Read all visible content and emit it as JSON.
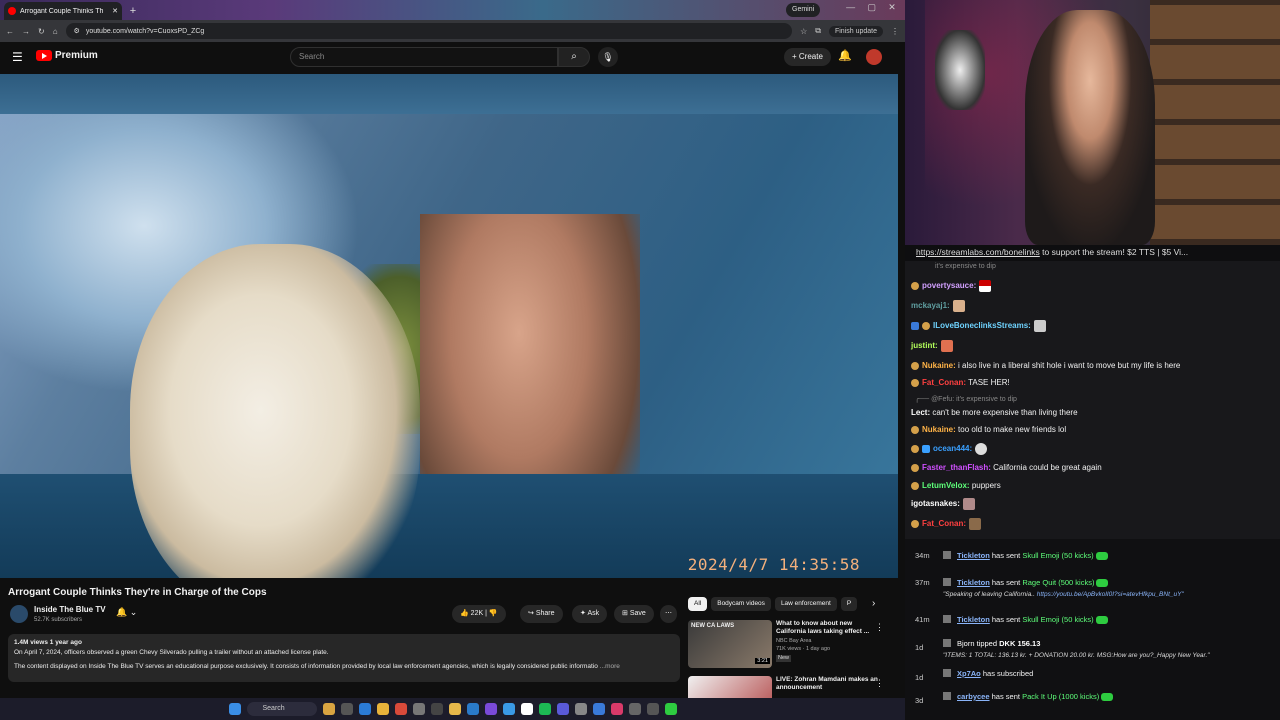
{
  "browser": {
    "tab_title": "Arrogant Couple Thinks Th",
    "new_tab": "+",
    "gemini_label": "Gemini",
    "url": "youtube.com/watch?v=CuoxsPD_ZCg",
    "finish_update": "Finish update"
  },
  "youtube": {
    "logo_text": "Premium",
    "search_placeholder": "Search",
    "create_label": "Create",
    "video_timestamp_overlay": "2024/4/7  14:35:58",
    "video_title": "Arrogant Couple Thinks They're in Charge of the Cops",
    "channel_name": "Inside The Blue TV",
    "channel_subs": "52.7K subscribers",
    "like_count": "22K",
    "share_label": "Share",
    "ask_label": "Ask",
    "save_label": "Save",
    "desc_stats": "1.4M views  1 year ago",
    "desc_line1": "On April 7, 2024, officers observed a green Chevy Silverado pulling a trailer without an attached license plate.",
    "desc_line2": "The content displayed on Inside The Blue TV serves an educational purpose exclusively. It consists of information provided by local law enforcement agencies, which is legally considered public informatio",
    "desc_more": "...more",
    "chips": [
      "All",
      "Bodycam videos",
      "Law enforcement",
      "P"
    ],
    "recs": [
      {
        "title": "What to know about new California laws taking effect ...",
        "channel": "NBC Bay Area",
        "meta": "71K views · 1 day ago",
        "badge": "New",
        "duration": "3:21",
        "thumb_text": "NEW CA LAWS"
      },
      {
        "title": "LIVE: Zohran Mamdani makes an announcement",
        "channel": "",
        "meta": "",
        "badge": "",
        "duration": "",
        "thumb_text": ""
      }
    ]
  },
  "taskbar": {
    "search_label": "Search"
  },
  "stream": {
    "banner_link": "https://streamlabs.com/bonelinks",
    "banner_text": " to support the stream! $2 TTS | $5 Vi..."
  },
  "chat": {
    "top_fragment": "it's expensive to dip",
    "messages": [
      {
        "user": "povertysauce:",
        "text": "",
        "color": "#d2a0ff"
      },
      {
        "user": "mckayaj1:",
        "text": "",
        "color": "#5f9ea0"
      },
      {
        "user": "ILoveBoneclinksStreams:",
        "text": "",
        "color": "#6fd3ff"
      },
      {
        "user": "justint:",
        "text": "",
        "color": "#b3ff5a"
      },
      {
        "user": "Nukaine:",
        "text": "i also live in a liberal shit hole i want to move but my life is here",
        "color": "#ffb347"
      },
      {
        "user": "Fat_Conan:",
        "text": "TASE HER!",
        "color": "#ff4040"
      },
      {
        "user": "Lect:",
        "text": "can't be more expensive than living there",
        "color": "#ffffff"
      },
      {
        "user": "Nukaine:",
        "text": "too old to make new friends lol",
        "color": "#ffb347"
      },
      {
        "user": "ocean444:",
        "text": "",
        "color": "#3aa0ff"
      },
      {
        "user": "Faster_thanFlash:",
        "text": "California could be great again",
        "color": "#d050ff"
      },
      {
        "user": "LetumVelox:",
        "text": "puppers",
        "color": "#5eff7a"
      },
      {
        "user": "igotasnakes:",
        "text": "",
        "color": "#ffffff"
      },
      {
        "user": "Fat_Conan:",
        "text": "",
        "color": "#ff4040"
      }
    ],
    "reply_fefu": "@Fefu: it's expensive to dip"
  },
  "events": [
    {
      "time": "34m",
      "user": "Tickleton",
      "action": "has sent",
      "item": "Skull Emoji (50 kicks)",
      "sub": ""
    },
    {
      "time": "37m",
      "user": "Tickleton",
      "action": "has sent",
      "item": "Rage Quit (500 kicks)",
      "sub": "\"Speaking of leaving California..",
      "sub_link": "https://youtu.be/ApBvkolI0I?si=atevHfkpu_BNt_uY\""
    },
    {
      "time": "41m",
      "user": "Tickleton",
      "action": "has sent",
      "item": "Skull Emoji (50 kicks)",
      "sub": ""
    },
    {
      "time": "1d",
      "user": "Bjorn tipped",
      "action": "",
      "item": "DKK 156.13",
      "sub": "\"ITEMS: 1 TOTAL: 136.13 kr. + DONATION 20.00 kr. MSG:How are you?_Happy New Year.\""
    },
    {
      "time": "1d",
      "user": "Xp7Ao",
      "action": "has subscribed",
      "item": "",
      "sub": ""
    },
    {
      "time": "3d",
      "user": "carbycee",
      "action": "has sent",
      "item": "Pack It Up (1000 kicks)",
      "sub": ""
    }
  ],
  "colors": {
    "yt_red": "#ff0000",
    "chat_bg": "#18181b",
    "gift_green": "#5eff7a"
  }
}
